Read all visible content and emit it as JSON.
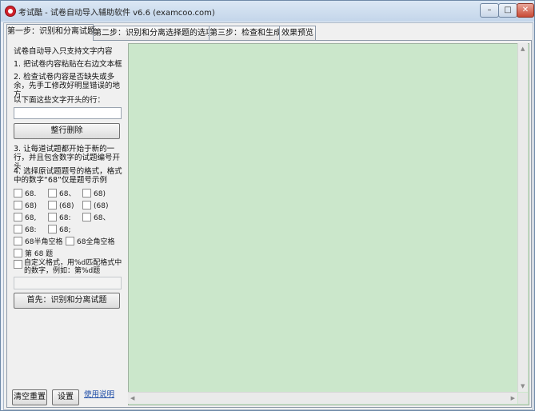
{
  "window": {
    "title": "考试酷 - 试卷自动导入辅助软件 v6.6 (examcoo.com)",
    "controls": {
      "minimize": "–",
      "maximize": "□",
      "close": "✕"
    }
  },
  "tabs": [
    {
      "label": "第一步：识别和分离试题"
    },
    {
      "label": "第二步：识别和分离选择题的选项"
    },
    {
      "label": "第三步：检查和生成"
    },
    {
      "label": "效果预览"
    }
  ],
  "left_panel": {
    "intro": "试卷自动导入只支持文字内容",
    "step1": "1. 把试卷内容粘贴在右边文本框",
    "step2": "2. 检查试卷内容是否缺失或多余，先手工修改好明显错误的地方",
    "remove_label": "以下面这些文字开头的行：",
    "remove_value": "",
    "remove_button": "整行删除",
    "step3": "3. 让每道试题都开始于新的一行，并且包含数字的试题编号开头",
    "step4": "4. 选择原试题题号的格式，格式中的数字“68”仅是题号示例",
    "formats": [
      [
        "68.",
        "68、",
        "68)"
      ],
      [
        "68)",
        "(68)",
        "(68)"
      ],
      [
        "68,",
        "68:",
        "68、"
      ],
      [
        "68:",
        "68;"
      ]
    ],
    "format_half_space": "68半角空格",
    "format_full_space": "68全角空格",
    "format_di_ti": "第 68 题",
    "custom_format": "自定义格式，用%d匹配格式中的数字，例如：第%d题",
    "custom_value": "",
    "identify_button": "首先：识别和分离试题",
    "clear_button": "清空重置",
    "settings_button": "设置",
    "help_link": "使用说明"
  },
  "editor": {
    "content": ""
  },
  "colors": {
    "editor_bg": "#cbe7cb",
    "title_gradient": "#c3d5ea",
    "close_button": "#c94a36"
  }
}
